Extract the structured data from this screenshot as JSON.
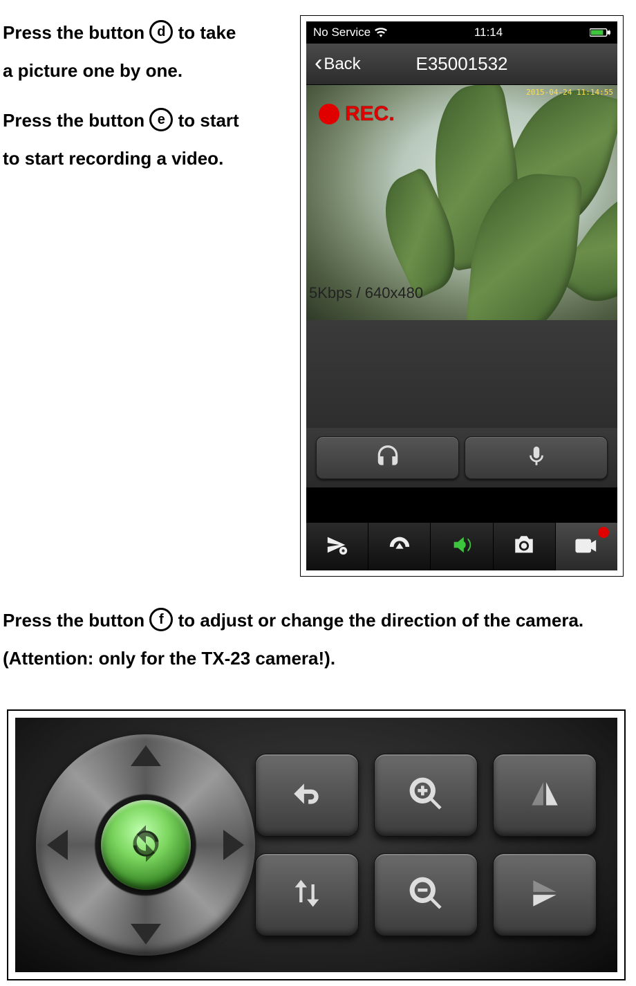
{
  "icons": {
    "d": "d",
    "e": "e",
    "f": "f"
  },
  "instructions": {
    "take_picture_pre": "Press the button ",
    "take_picture_post": " to take a picture one by one.",
    "record_pre": "Press the button ",
    "record_post": " to start to start recording a video.",
    "direction_pre": "Press the button ",
    "direction_post": " to adjust or change the direction of the camera. (Attention: only for the TX-23 camera!)."
  },
  "phone": {
    "status": {
      "service": "No Service",
      "time": "11:14"
    },
    "nav": {
      "back": "Back",
      "title": "E35001532"
    },
    "video": {
      "rec_label": "REC.",
      "timestamp": "2015-04-24 11:14:55",
      "meta": "5Kbps / 640x480"
    }
  }
}
